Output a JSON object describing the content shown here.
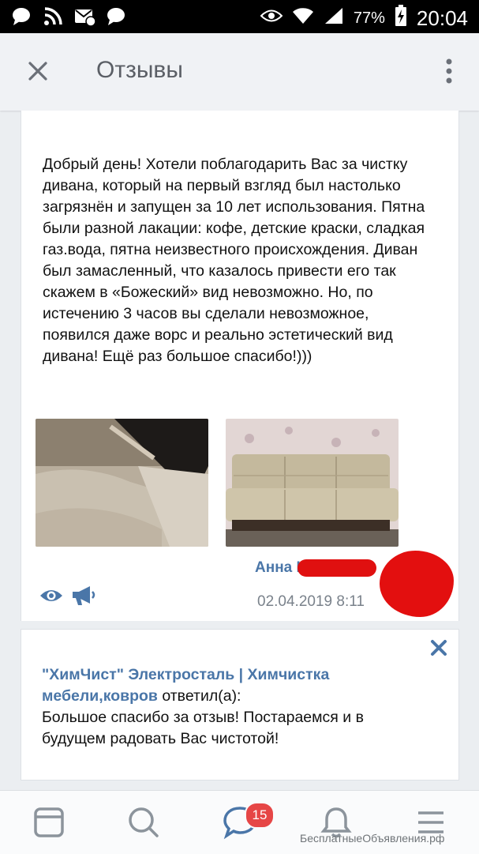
{
  "status_bar": {
    "battery": "77%",
    "time": "20:04"
  },
  "header": {
    "title": "Отзывы"
  },
  "review": {
    "text": "Добрый день! Хотели поблагодарить Вас за чистку дивана, который на первый взгляд был настолько загрязнён и запущен за 10 лет использования. Пятна были разной лакации: кофе, детские краски, сладкая газ.вода, пятна неизвестного происхождения. Диван был замасленный, что казалось привести его так скажем в «Божеский» вид невозможно. Но, по истечению 3 часов вы сделали невозможное, появился даже ворс и реально эстетический вид дивана! Ещё раз большое спасибо!)))",
    "author": "Анна К",
    "date": "02.04.2019 8:11"
  },
  "reply": {
    "company": "\"ХимЧист\" Электросталь | Химчистка мебели,ковров",
    "replied_label": " ответил(а):",
    "text": "Большое спасибо за отзыв! Постараемся и в будущем радовать Вас чистотой!"
  },
  "bottom_nav": {
    "items": [
      "news-icon",
      "search-icon",
      "messages-icon",
      "notifications-icon",
      "menu-icon"
    ],
    "messages_badge": "15"
  },
  "watermark": "БесплатныеОбъявления.рф",
  "colors": {
    "accent": "#4a76a8",
    "badge": "#e64646",
    "redaction": "#e30f0f"
  }
}
